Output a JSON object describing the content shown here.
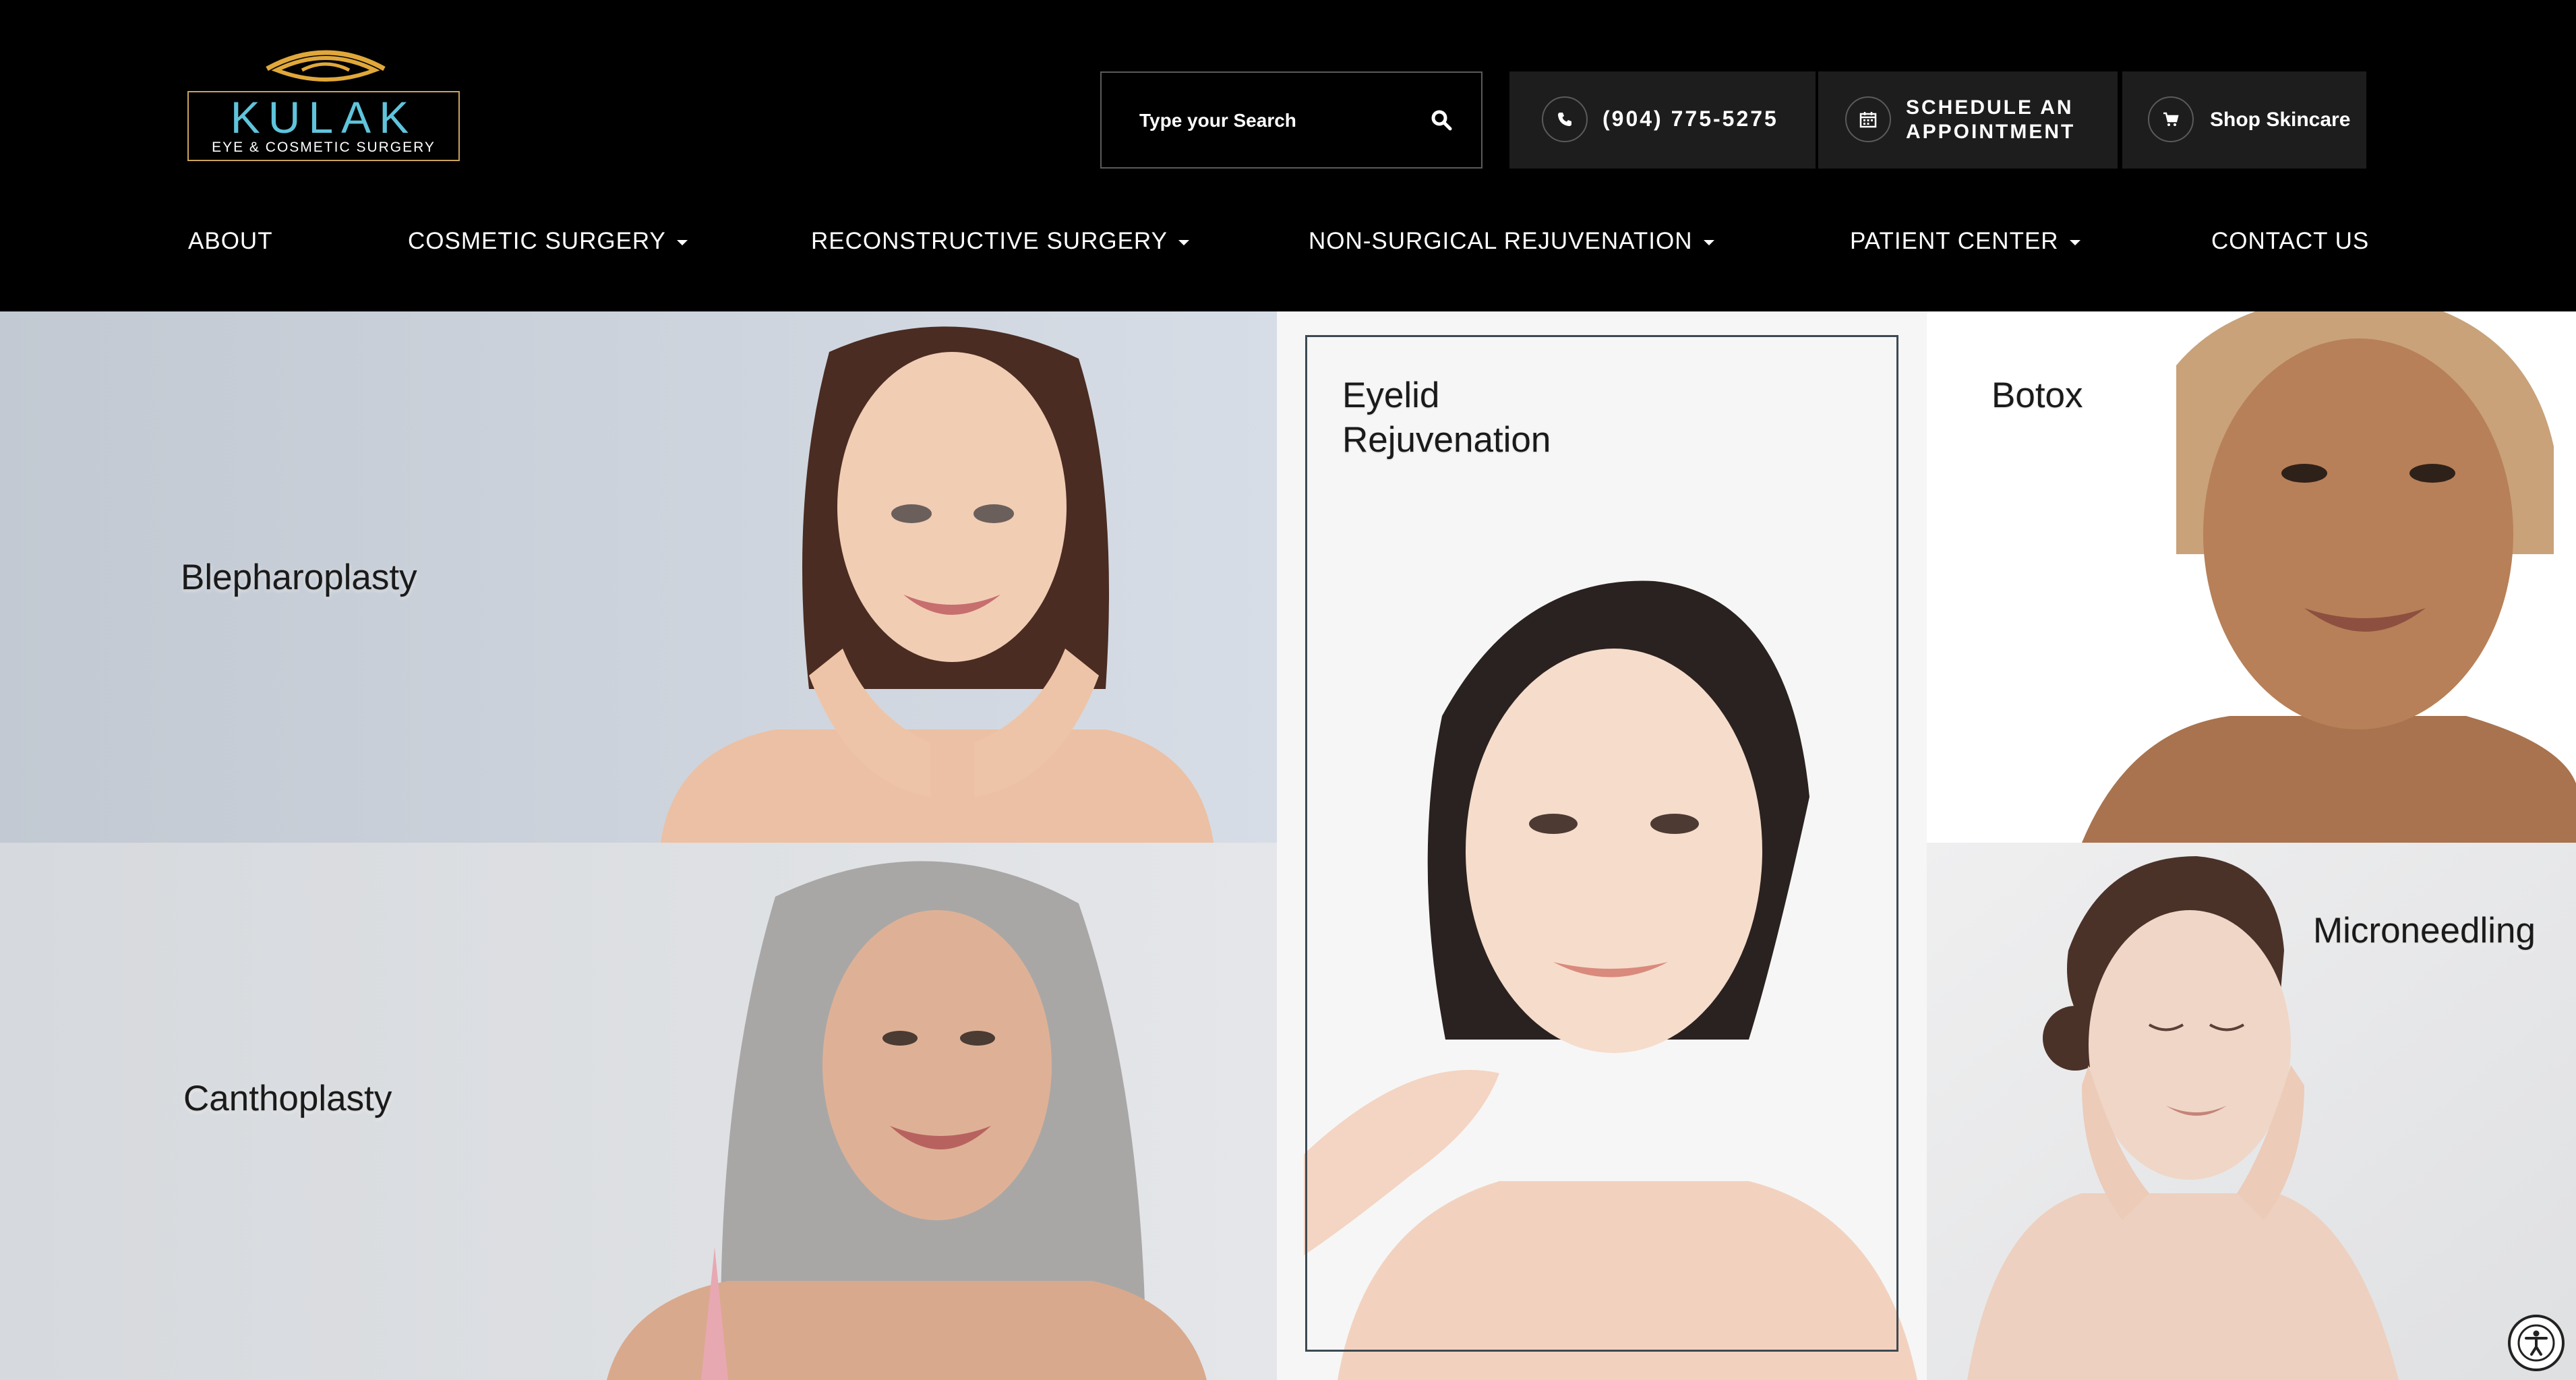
{
  "brand": {
    "name": "KULAK",
    "tagline": "EYE & COSMETIC SURGERY",
    "accent_gold": "#c9a35a",
    "accent_teal": "#5fc4dc"
  },
  "search": {
    "placeholder": "Type your Search",
    "icon": "search-icon"
  },
  "actions": {
    "phone": {
      "label": "(904) 775-5275",
      "icon": "phone-icon"
    },
    "schedule": {
      "line1": "SCHEDULE AN",
      "line2": "APPOINTMENT",
      "icon": "calendar-icon"
    },
    "shop": {
      "label": "Shop Skincare",
      "icon": "cart-icon"
    }
  },
  "nav": {
    "about": "ABOUT",
    "cosmetic": "COSMETIC SURGERY",
    "reconstructive": "RECONSTRUCTIVE SURGERY",
    "nonsurgical": "NON-SURGICAL REJUVENATION",
    "patient": "PATIENT CENTER",
    "contact": "CONTACT US"
  },
  "tiles": {
    "blepharoplasty": "Blepharoplasty",
    "eyelid_line1": "Eyelid",
    "eyelid_line2": "Rejuvenation",
    "botox": "Botox",
    "canthoplasty": "Canthoplasty",
    "microneedling": "Microneedling"
  },
  "accessibility": {
    "icon": "accessibility-icon"
  }
}
